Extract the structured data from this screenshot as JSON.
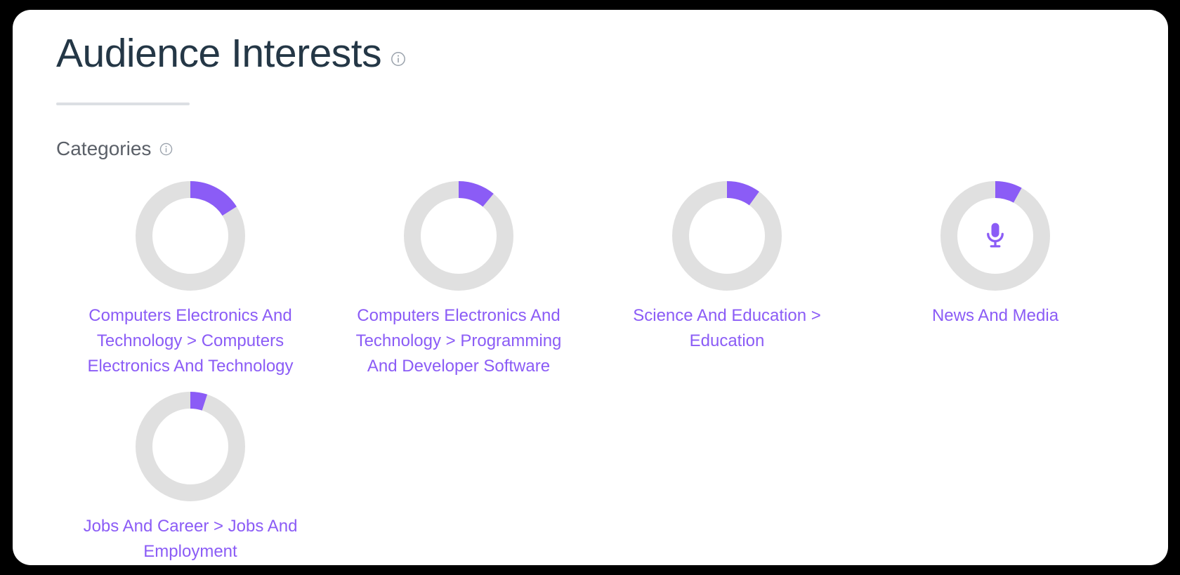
{
  "colors": {
    "accent": "#8B5CF6",
    "track": "#E0E0E0",
    "title": "#243746",
    "label": "#5B6068",
    "divider": "#DCDFE3",
    "card": "#FFFFFF",
    "page_background": "#000000"
  },
  "header": {
    "title": "Audience Interests",
    "info_icon": "info-circle-icon"
  },
  "section": {
    "label": "Categories",
    "info_icon": "info-circle-icon"
  },
  "chart_data": {
    "type": "pie",
    "title": "Audience Interests — Categories",
    "notes": "Five donut gauges; each shows the share of audience in one interest category. Arc starts at 12 o'clock and sweeps clockwise.",
    "legend_position": "below each donut",
    "categories": [
      "Computers Electronics And Technology > Computers Electronics And Technology",
      "Computers Electronics And Technology > Programming And Developer Software",
      "Science And Education > Education",
      "News And Media",
      "Jobs And Career > Jobs And Employment"
    ],
    "values": [
      16,
      11,
      10,
      8,
      5
    ],
    "ylim": [
      0,
      100
    ]
  },
  "donuts": [
    {
      "label": "Computers Electronics And Technology > Computers Electronics And Technology",
      "percent": 16,
      "center_icon": ""
    },
    {
      "label": "Computers Electronics And Technology > Programming And Developer Software",
      "percent": 11,
      "center_icon": ""
    },
    {
      "label": "Science And Education > Education",
      "percent": 10,
      "center_icon": ""
    },
    {
      "label": "News And Media",
      "percent": 8,
      "center_icon": "microphone-icon"
    },
    {
      "label": "Jobs And Career > Jobs And Employment",
      "percent": 5,
      "center_icon": ""
    }
  ]
}
